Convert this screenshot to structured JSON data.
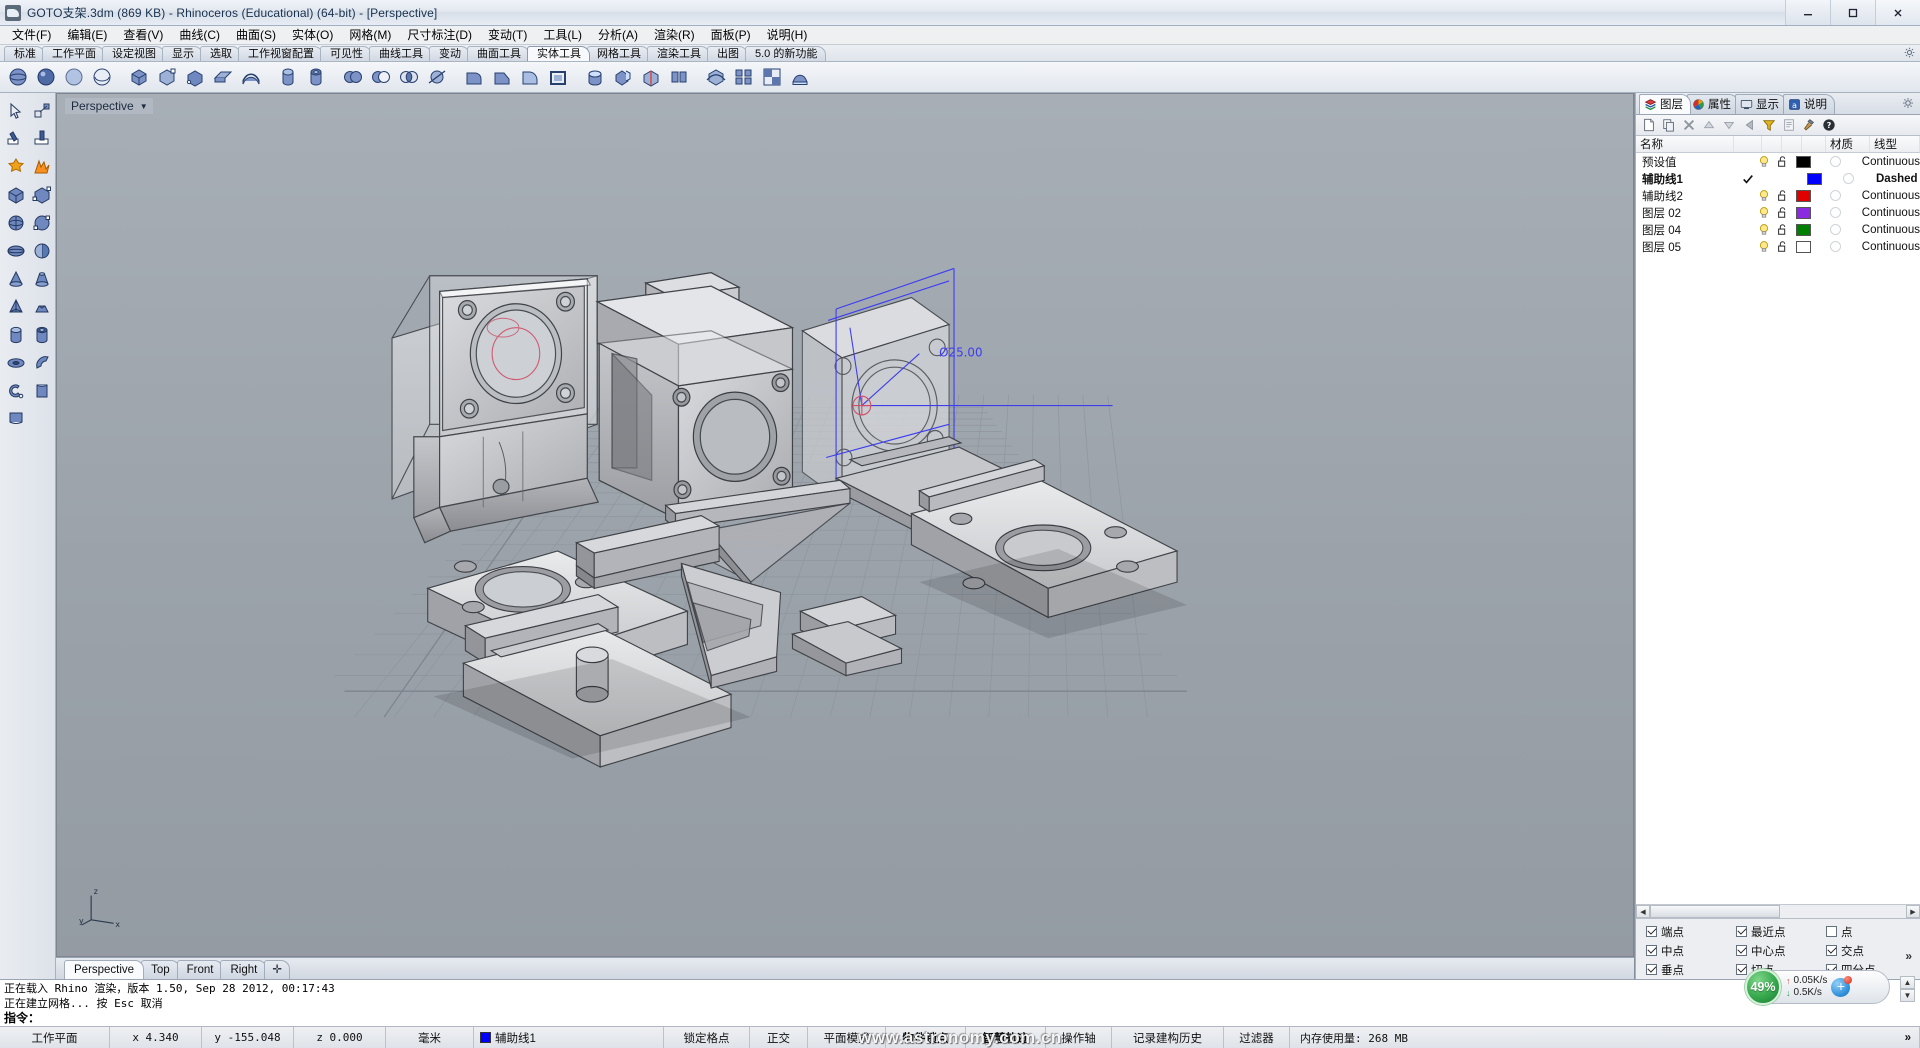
{
  "window": {
    "title": "GOTO支架.3dm (869 KB) - Rhinoceros (Educational) (64-bit) - [Perspective]",
    "minimize_label": "—",
    "maximize_label": "☐",
    "close_label": "✕"
  },
  "menu": {
    "items": [
      {
        "label": "文件(F)",
        "name": "menu-file"
      },
      {
        "label": "编辑(E)",
        "name": "menu-edit"
      },
      {
        "label": "查看(V)",
        "name": "menu-view"
      },
      {
        "label": "曲线(C)",
        "name": "menu-curve"
      },
      {
        "label": "曲面(S)",
        "name": "menu-surface"
      },
      {
        "label": "实体(O)",
        "name": "menu-solid"
      },
      {
        "label": "网格(M)",
        "name": "menu-mesh"
      },
      {
        "label": "尺寸标注(D)",
        "name": "menu-dimension"
      },
      {
        "label": "变动(T)",
        "name": "menu-transform"
      },
      {
        "label": "工具(L)",
        "name": "menu-tools"
      },
      {
        "label": "分析(A)",
        "name": "menu-analyze"
      },
      {
        "label": "渲染(R)",
        "name": "menu-render"
      },
      {
        "label": "面板(P)",
        "name": "menu-panels"
      },
      {
        "label": "说明(H)",
        "name": "menu-help"
      }
    ]
  },
  "toolbar_tabs": {
    "items": [
      {
        "label": "标准",
        "active": false
      },
      {
        "label": "工作平面",
        "active": false
      },
      {
        "label": "设定视图",
        "active": false
      },
      {
        "label": "显示",
        "active": false
      },
      {
        "label": "选取",
        "active": false
      },
      {
        "label": "工作视窗配置",
        "active": false
      },
      {
        "label": "可见性",
        "active": false
      },
      {
        "label": "曲线工具",
        "active": false
      },
      {
        "label": "变动",
        "active": false
      },
      {
        "label": "曲面工具",
        "active": false
      },
      {
        "label": "实体工具",
        "active": true
      },
      {
        "label": "网格工具",
        "active": false
      },
      {
        "label": "渲染工具",
        "active": false
      },
      {
        "label": "出图",
        "active": false
      },
      {
        "label": "5.0 的新功能",
        "active": false
      }
    ]
  },
  "main_toolbar": {
    "icons": [
      "box-icon",
      "box-corner-icon",
      "sphere-icon",
      "cylinder-icon",
      "cone-icon",
      "truncated-cone-icon",
      "pyramid-icon",
      "torus-icon",
      "tube-icon",
      "pipe-icon",
      "extrude-solid-icon",
      "extrude-along-curve-icon",
      "boolean-union-icon",
      "boolean-difference-icon",
      "boolean-intersect-icon",
      "cap-planar-holes-icon",
      "fillet-edge-icon",
      "chamfer-edge-icon",
      "shell-icon",
      "offset-surface-icon",
      "split-solid-icon",
      "extract-surface-icon",
      "mesh-from-nurbs-icon",
      "wirecut-icon",
      "array-icon",
      "unroll-icon",
      "explode-icon",
      "join-icon"
    ]
  },
  "left_palette": {
    "icons": [
      "select-arrow-icon",
      "select-window-icon",
      "split-icon",
      "trim-icon",
      "explode-icon",
      "boolean-burst-icon",
      "box-icon",
      "box-corner-to-corner-icon",
      "sphere-icon",
      "sphere-3point-icon",
      "ellipsoid-icon",
      "cut-sphere-icon",
      "cone-icon",
      "truncated-cone-icon",
      "pyramid-icon",
      "truncated-pyramid-icon",
      "cylinder-icon",
      "tube-icon",
      "torus-icon",
      "pipe-icon",
      "spiral-solid-icon",
      "extrude-solid-icon",
      "surface-patch-icon"
    ]
  },
  "viewport": {
    "label": "Perspective",
    "caret": "▼",
    "axis": {
      "x": "x",
      "y": "y",
      "z": "z"
    },
    "annotation": "Ø25.00"
  },
  "viewport_tabs": {
    "items": [
      {
        "label": "Perspective",
        "active": true
      },
      {
        "label": "Top",
        "active": false
      },
      {
        "label": "Front",
        "active": false
      },
      {
        "label": "Right",
        "active": false
      }
    ],
    "add_label": "✛"
  },
  "right_panel": {
    "tabs": [
      {
        "label": "图层",
        "icon": "layers-icon",
        "active": true
      },
      {
        "label": "属性",
        "icon": "properties-icon",
        "active": false
      },
      {
        "label": "显示",
        "icon": "display-icon",
        "active": false
      },
      {
        "label": "说明",
        "icon": "notes-icon",
        "active": false
      }
    ],
    "gear_icon": "gear-icon",
    "toolbar_icons": [
      "new-layer-icon",
      "copy-layer-icon",
      "delete-layer-icon",
      "move-up-icon",
      "move-down-icon",
      "back-icon",
      "filter-icon",
      "properties-page-icon",
      "tools-hammer-icon",
      "help-icon"
    ],
    "columns": {
      "name": "名称",
      "current": "",
      "on": "",
      "lock": "",
      "color": "",
      "material": "材质",
      "linetype": "线型"
    },
    "layers": [
      {
        "name": "预设值",
        "current": false,
        "on": true,
        "locked": false,
        "color": "#000000",
        "linetype": "Continuous",
        "arrow": "#000000",
        "arrow_filled": true
      },
      {
        "name": "辅助线1",
        "current": true,
        "on": true,
        "locked": false,
        "color": "#0000ff",
        "linetype": "Dashed",
        "arrow": "#0000cc",
        "arrow_filled": true
      },
      {
        "name": "辅助线2",
        "current": false,
        "on": true,
        "locked": false,
        "color": "#e00000",
        "linetype": "Continuous",
        "arrow": "#cc0000",
        "arrow_filled": true
      },
      {
        "name": "图层 02",
        "current": false,
        "on": true,
        "locked": false,
        "color": "#8a2be2",
        "linetype": "Continuous",
        "arrow": "#7a1fd0",
        "arrow_filled": true
      },
      {
        "name": "图层 04",
        "current": false,
        "on": true,
        "locked": false,
        "color": "#008000",
        "linetype": "Continuous",
        "arrow": "#007000",
        "arrow_filled": true
      },
      {
        "name": "图层 05",
        "current": false,
        "on": true,
        "locked": false,
        "color": "#ffffff",
        "linetype": "Continuous",
        "arrow": "#ffffff",
        "arrow_filled": false
      }
    ],
    "scroll": {
      "left": "◀",
      "right": "▶"
    }
  },
  "osnap": {
    "items": [
      {
        "label": "端点",
        "checked": true
      },
      {
        "label": "最近点",
        "checked": true
      },
      {
        "label": "点",
        "checked": false
      },
      {
        "label": "中点",
        "checked": true
      },
      {
        "label": "中心点",
        "checked": true
      },
      {
        "label": "交点",
        "checked": true
      },
      {
        "label": "垂点",
        "checked": true
      },
      {
        "label": "切点",
        "checked": true
      },
      {
        "label": "四分点",
        "checked": true
      }
    ],
    "more": "»"
  },
  "net_widget": {
    "percent": "49%",
    "upload": "0.05K/s",
    "download": "0.5K/s",
    "up_arrow": "↑",
    "down_arrow": "↓",
    "plus": "+"
  },
  "command_area": {
    "history": [
      "正在载入 Rhino 渲染，版本 1.50, Sep 28 2012, 00:17:43",
      "正在建立网格... 按 Esc 取消"
    ],
    "prompt": "指令：",
    "input_value": ""
  },
  "status_bar": {
    "cplane": "工作平面",
    "x": "x 4.340",
    "y": "y -155.048",
    "z": "z 0.000",
    "units": "毫米",
    "layer": "辅助线1",
    "layer_color": "#0000ff",
    "toggles": [
      {
        "label": "锁定格点",
        "on": false
      },
      {
        "label": "正交",
        "on": false
      },
      {
        "label": "平面模式",
        "on": false
      },
      {
        "label": "物件锁点",
        "on": true
      },
      {
        "label": "智慧轨迹",
        "on": true
      },
      {
        "label": "操作轴",
        "on": false
      },
      {
        "label": "记录建构历史",
        "on": false
      },
      {
        "label": "过滤器",
        "on": false
      }
    ],
    "memory": "内存使用量: 268 MB",
    "chevron": "»"
  },
  "watermark": "www.astronomy.com.cn"
}
